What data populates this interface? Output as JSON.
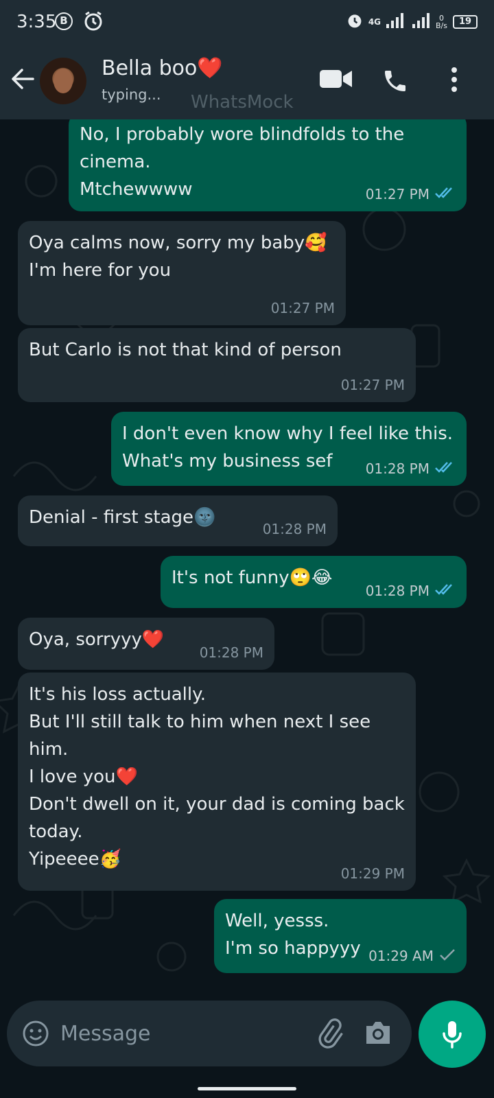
{
  "status_bar": {
    "time": "3:35",
    "b_badge": "B",
    "network": "4G",
    "speed_value": "0",
    "speed_unit": "B/s",
    "battery": "19"
  },
  "header": {
    "contact_name": "Bella boo❤️",
    "status": "typing...",
    "watermark": "WhatsMock"
  },
  "colors": {
    "incoming_bubble": "#202c33",
    "outgoing_bubble": "#005c4b",
    "accent": "#00a884",
    "read_ticks": "#53bdeb"
  },
  "messages": [
    {
      "dir": "out",
      "text": "No, I probably wore blindfolds to the\ncinema.\nMtchewwww",
      "time": "01:27 PM",
      "ticks": "read"
    },
    {
      "dir": "in",
      "text": "Oya calms now, sorry my baby🥰\nI'm here for you",
      "time": "01:27 PM"
    },
    {
      "dir": "in",
      "text": "But Carlo is not that kind of person",
      "time": "01:27 PM"
    },
    {
      "dir": "out",
      "text": "I don't even know why I feel like this.\nWhat's my business sef",
      "time": "01:28 PM",
      "ticks": "read"
    },
    {
      "dir": "in",
      "text": "Denial - first stage🌚",
      "time": "01:28 PM"
    },
    {
      "dir": "out",
      "text": "It's not funny🙄😂",
      "time": "01:28 PM",
      "ticks": "read"
    },
    {
      "dir": "in",
      "text": "Oya, sorryyy❤️",
      "time": "01:28 PM"
    },
    {
      "dir": "in",
      "text": "It's his loss actually.\nBut I'll still talk to him when next I see\nhim.\nI love you❤️\nDon't dwell on it, your dad is coming back\ntoday.\nYipeeee🥳",
      "time": "01:29 PM"
    },
    {
      "dir": "out",
      "text": "Well, yesss.\nI'm so happyyy",
      "time": "01:29 AM",
      "ticks": "sent"
    }
  ],
  "composer": {
    "placeholder": "Message"
  }
}
